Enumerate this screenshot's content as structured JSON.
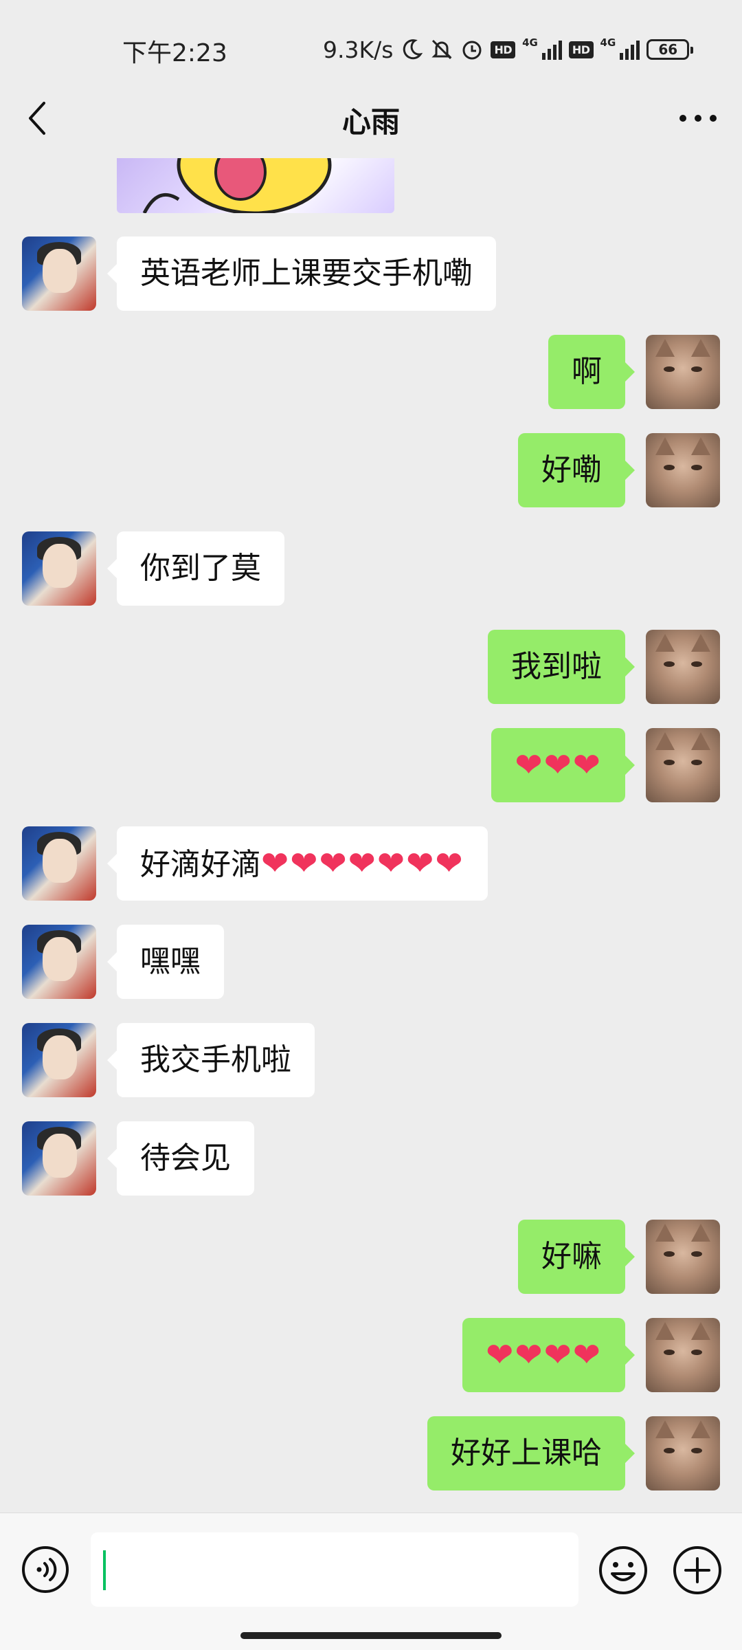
{
  "status_bar": {
    "time": "下午2:23",
    "speed": "9.3K/s",
    "hd1": "HD",
    "hd2": "HD",
    "net1": "4G",
    "net2": "4G",
    "battery": "66"
  },
  "header": {
    "title": "心雨"
  },
  "messages": [
    {
      "side": "left",
      "text": "英语老师上课要交手机嘞"
    },
    {
      "side": "right",
      "text": "啊"
    },
    {
      "side": "right",
      "text": "好嘞"
    },
    {
      "side": "left",
      "text": "你到了莫"
    },
    {
      "side": "right",
      "text": "我到啦"
    },
    {
      "side": "right",
      "text": "❤❤❤"
    },
    {
      "side": "left",
      "text": "好滴好滴",
      "hearts": "❤❤❤❤❤❤❤"
    },
    {
      "side": "left",
      "text": "嘿嘿"
    },
    {
      "side": "left",
      "text": "我交手机啦"
    },
    {
      "side": "left",
      "text": "待会见"
    },
    {
      "side": "right",
      "text": "好嘛"
    },
    {
      "side": "right",
      "text": "❤❤❤❤"
    },
    {
      "side": "right",
      "text": "好好上课哈"
    }
  ],
  "input": {
    "value": "",
    "placeholder": ""
  },
  "icons": {
    "back": "chevron-left-icon",
    "more": "more-dots-icon",
    "voice": "voice-icon",
    "emoji": "emoji-icon",
    "plus": "plus-icon"
  },
  "colors": {
    "background": "#ededed",
    "outgoing_bubble": "#95ec69",
    "incoming_bubble": "#ffffff",
    "heart": "#f0335c",
    "caret": "#07c160"
  }
}
